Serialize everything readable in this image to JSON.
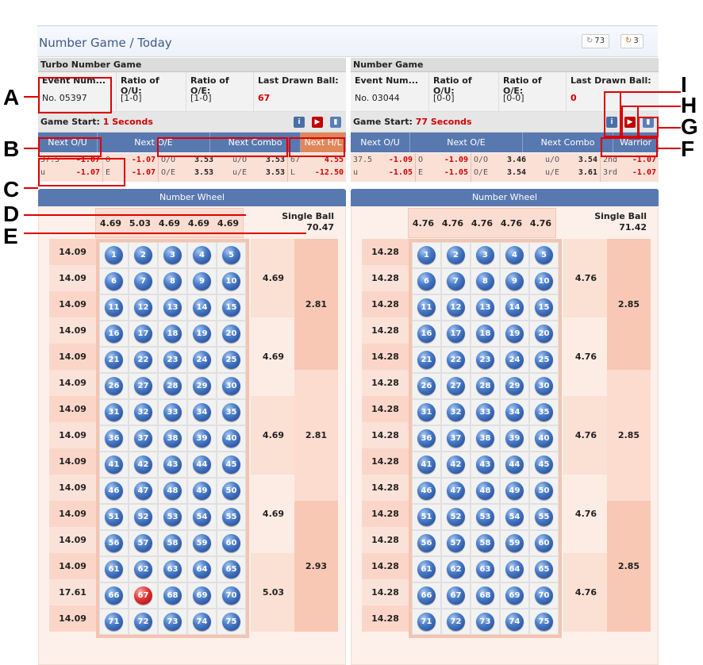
{
  "title": "Number Game / Today",
  "refresh_buttons": [
    {
      "label": "73"
    },
    {
      "label": "3"
    }
  ],
  "refresh_icons": [
    "refresh-icon",
    "refresh-icon"
  ],
  "panels": [
    {
      "name": "Turbo Number Game",
      "event_label": "Event Num...",
      "event_no": "No. 05397",
      "ou_label": "Ratio of O/U:",
      "ou_value": "[1-0]",
      "oe_label": "Ratio of O/E:",
      "oe_value": "[1-0]",
      "last_label": "Last Drawn Ball:",
      "last_value": "67",
      "game_start_label": "Game Start:",
      "game_start_value": "1 Seconds",
      "tabs": [
        "Next O/U",
        "Next O/E",
        "Next Combo",
        "Next H/L"
      ],
      "odds": {
        "ou": [
          [
            "37.5",
            "-1.07"
          ],
          [
            "u",
            "-1.07"
          ]
        ],
        "oe": [
          [
            "O",
            "-1.07"
          ],
          [
            "E",
            "-1.07"
          ]
        ],
        "combo": [
          [
            "O/O",
            "3.53",
            "u/O",
            "3.53"
          ],
          [
            "O/E",
            "3.53",
            "u/E",
            "3.53"
          ]
        ],
        "last": [
          [
            "67",
            "4.55"
          ],
          [
            "L",
            "-12.50"
          ]
        ]
      },
      "wheel_label": "Number Wheel",
      "column_odds": [
        "4.69",
        "5.03",
        "4.69",
        "4.69",
        "4.69"
      ],
      "single_ball_label": "Single Ball",
      "single_ball_value": "70.47",
      "row_odds": [
        "14.09",
        "14.09",
        "14.09",
        "14.09",
        "14.09",
        "14.09",
        "14.09",
        "14.09",
        "14.09",
        "14.09",
        "14.09",
        "14.09",
        "14.09",
        "17.61",
        "14.09"
      ],
      "group_odds": [
        "4.69",
        "4.69",
        "4.69",
        "4.69",
        "5.03"
      ],
      "col3_odds": [
        "2.81",
        "2.81",
        "2.93"
      ],
      "last_drawn_ball": 67
    },
    {
      "name": "Number Game",
      "event_label": "Event Num...",
      "event_no": "No. 03044",
      "ou_label": "Ratio of O/U:",
      "ou_value": "[0-0]",
      "oe_label": "Ratio of O/E:",
      "oe_value": "[0-0]",
      "last_label": "Last Drawn Ball:",
      "last_value": "0",
      "game_start_label": "Game Start:",
      "game_start_value": "77 Seconds",
      "tabs": [
        "Next O/U",
        "Next O/E",
        "Next Combo",
        "Warrior"
      ],
      "odds": {
        "ou": [
          [
            "37.5",
            "-1.09"
          ],
          [
            "u",
            "-1.05"
          ]
        ],
        "oe": [
          [
            "O",
            "-1.09"
          ],
          [
            "E",
            "-1.05"
          ]
        ],
        "combo": [
          [
            "O/O",
            "3.46",
            "u/O",
            "3.54"
          ],
          [
            "O/E",
            "3.54",
            "u/E",
            "3.61"
          ]
        ],
        "last": [
          [
            "2nd",
            "-1.07"
          ],
          [
            "3rd",
            "-1.07"
          ]
        ]
      },
      "wheel_label": "Number Wheel",
      "column_odds": [
        "4.76",
        "4.76",
        "4.76",
        "4.76",
        "4.76"
      ],
      "single_ball_label": "Single Ball",
      "single_ball_value": "71.42",
      "row_odds": [
        "14.28",
        "14.28",
        "14.28",
        "14.28",
        "14.28",
        "14.28",
        "14.28",
        "14.28",
        "14.28",
        "14.28",
        "14.28",
        "14.28",
        "14.28",
        "14.28",
        "14.28"
      ],
      "group_odds": [
        "4.76",
        "4.76",
        "4.76",
        "4.76",
        "4.76"
      ],
      "col3_odds": [
        "2.85",
        "2.85",
        "2.85"
      ],
      "last_drawn_ball": null
    }
  ],
  "annotations": [
    "A",
    "B",
    "C",
    "D",
    "E",
    "F",
    "G",
    "H",
    "I"
  ],
  "icons": {
    "info": "info-icon",
    "play": "play-icon",
    "stats": "stats-icon"
  }
}
